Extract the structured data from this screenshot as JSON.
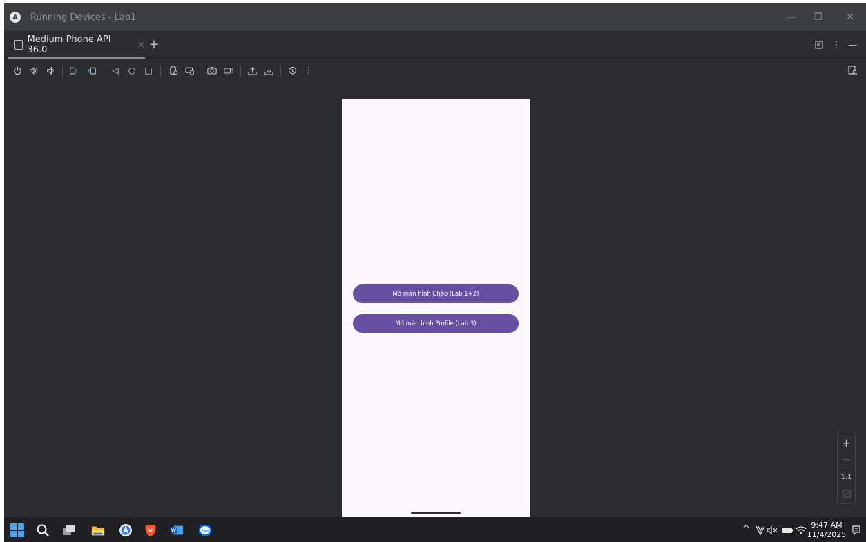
{
  "window": {
    "title": "Running Devices - Lab1",
    "controls": {
      "minimize": "—",
      "restore": "❐",
      "close": "✕"
    }
  },
  "tabs": {
    "active_label": "Medium Phone API 36.0",
    "close": "×",
    "add": "+"
  },
  "tab_tools": {
    "more": "⋮",
    "hide": "—"
  },
  "toolbar": {
    "power": "⏻",
    "volume_up": "🔊",
    "volume_down": "🔉",
    "rotate_left": "⟲",
    "rotate_right": "⟳",
    "back": "◁",
    "home": "○",
    "overview": "□",
    "more": "⋮"
  },
  "phone": {
    "buttons": [
      {
        "label": "Mở màn hình Chào (Lab 1+2)"
      },
      {
        "label": "Mở màn hình Profile (Lab 3)"
      }
    ],
    "background": "#fdf7fe",
    "button_color": "#6750a4"
  },
  "zoom": {
    "in": "+",
    "out": "—",
    "actual": "1:1"
  },
  "taskbar": {
    "time": "9:47 AM",
    "date": "11/4/2025",
    "tray": {
      "chevron": "^",
      "mute": "🔇",
      "wifi": "📶"
    },
    "apps": [
      "start-icon",
      "search-icon",
      "task-view-icon",
      "file-explorer-icon",
      "android-studio-icon",
      "brave-icon",
      "word-icon",
      "zalo-icon"
    ],
    "zalo_label": "Zalo",
    "word_label": "W"
  },
  "colors": {
    "ide_bg": "#2b2d30",
    "titlebar": "#3c3f41",
    "taskbar": "#1f1f24",
    "accent": "#6750a4"
  }
}
